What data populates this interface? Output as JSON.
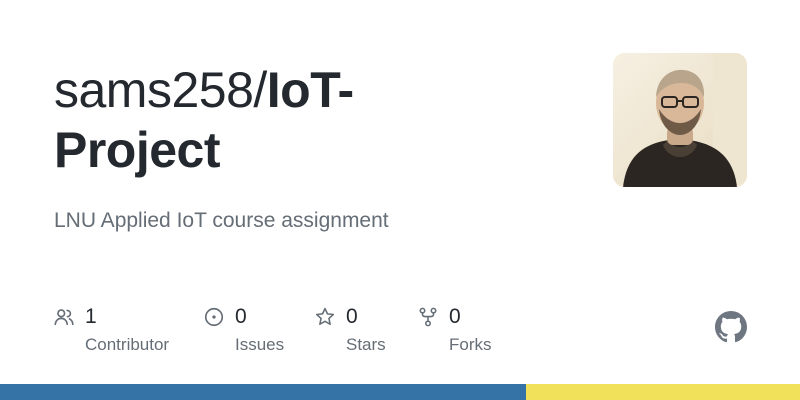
{
  "repo": {
    "owner": "sams258/",
    "name_part1": "IoT-",
    "name_part2": "Project",
    "description": "LNU Applied IoT course assignment"
  },
  "stats": [
    {
      "icon": "people-icon",
      "count": "1",
      "label": "Contributor"
    },
    {
      "icon": "issue-icon",
      "count": "0",
      "label": "Issues"
    },
    {
      "icon": "star-icon",
      "count": "0",
      "label": "Stars"
    },
    {
      "icon": "fork-icon",
      "count": "0",
      "label": "Forks"
    }
  ],
  "avatar": {
    "icon": "user-avatar-photo"
  },
  "brand": {
    "icon": "github-mark-icon",
    "color": "#6e7781"
  },
  "language_bar": [
    {
      "color": "#3572A5",
      "fraction": 0.657
    },
    {
      "color": "#f1e05a",
      "fraction": 0.343
    }
  ]
}
